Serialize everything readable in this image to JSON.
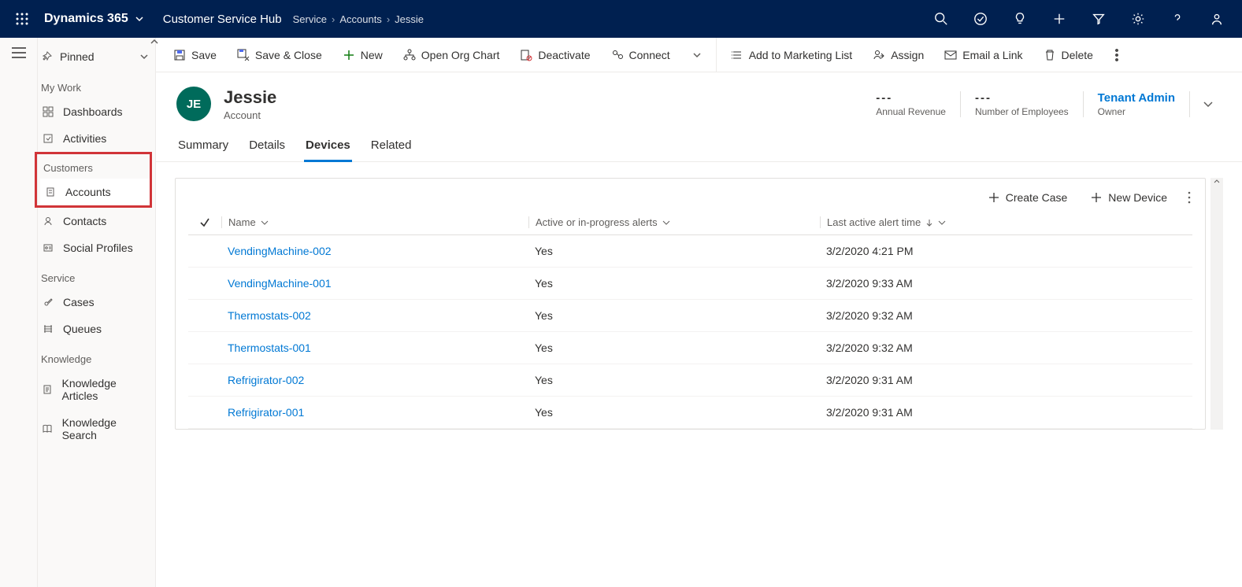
{
  "top": {
    "brand": "Dynamics 365",
    "hub": "Customer Service Hub",
    "breadcrumb": [
      "Service",
      "Accounts",
      "Jessie"
    ]
  },
  "sidebar": {
    "pinned": "Pinned",
    "groups": {
      "mywork": "My Work",
      "customers": "Customers",
      "service": "Service",
      "knowledge": "Knowledge"
    },
    "items": {
      "dashboards": "Dashboards",
      "activities": "Activities",
      "accounts": "Accounts",
      "contacts": "Contacts",
      "social": "Social Profiles",
      "cases": "Cases",
      "queues": "Queues",
      "karticles": "Knowledge Articles",
      "ksearch": "Knowledge Search"
    }
  },
  "commands": {
    "save": "Save",
    "saveclose": "Save & Close",
    "new": "New",
    "orgchart": "Open Org Chart",
    "deactivate": "Deactivate",
    "connect": "Connect",
    "marketing": "Add to Marketing List",
    "assign": "Assign",
    "emaillink": "Email a Link",
    "delete": "Delete"
  },
  "record": {
    "initials": "JE",
    "name": "Jessie",
    "type": "Account",
    "metrics": [
      {
        "value": "---",
        "label": "Annual Revenue"
      },
      {
        "value": "---",
        "label": "Number of Employees"
      }
    ],
    "owner": {
      "value": "Tenant Admin",
      "label": "Owner"
    }
  },
  "tabs": [
    "Summary",
    "Details",
    "Devices",
    "Related"
  ],
  "active_tab": "Devices",
  "panel": {
    "tools": {
      "createcase": "Create Case",
      "newdevice": "New Device"
    },
    "columns": {
      "name": "Name",
      "alerts": "Active or in-progress alerts",
      "time": "Last active alert time"
    },
    "rows": [
      {
        "name": "VendingMachine-002",
        "alerts": "Yes",
        "time": "3/2/2020 4:21 PM"
      },
      {
        "name": "VendingMachine-001",
        "alerts": "Yes",
        "time": "3/2/2020 9:33 AM"
      },
      {
        "name": "Thermostats-002",
        "alerts": "Yes",
        "time": "3/2/2020 9:32 AM"
      },
      {
        "name": "Thermostats-001",
        "alerts": "Yes",
        "time": "3/2/2020 9:32 AM"
      },
      {
        "name": "Refrigirator-002",
        "alerts": "Yes",
        "time": "3/2/2020 9:31 AM"
      },
      {
        "name": "Refrigirator-001",
        "alerts": "Yes",
        "time": "3/2/2020 9:31 AM"
      }
    ]
  }
}
